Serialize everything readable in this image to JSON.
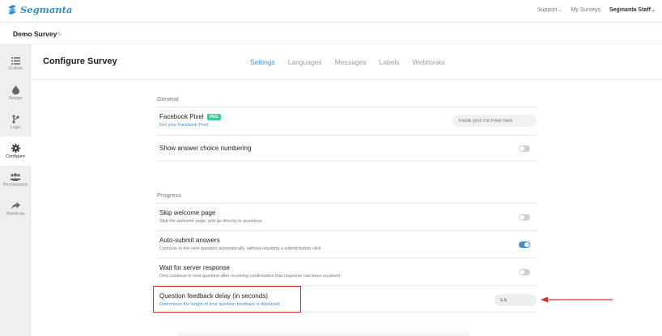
{
  "topbar": {
    "logo_text": "Segmanta",
    "support_label": "Support",
    "my_surveys_label": "My Surveys",
    "user_label": "Segmanta Staff"
  },
  "survey": {
    "title": "Demo Survey"
  },
  "sidebar": {
    "items": [
      {
        "label": "Outline",
        "icon": "list-icon"
      },
      {
        "label": "Design",
        "icon": "drop-icon"
      },
      {
        "label": "Logic",
        "icon": "branch-icon"
      },
      {
        "label": "Configure",
        "icon": "gear-icon"
      },
      {
        "label": "Permissions",
        "icon": "users-icon"
      },
      {
        "label": "Distribute",
        "icon": "share-icon"
      }
    ],
    "active": "Configure"
  },
  "page": {
    "title": "Configure Survey",
    "tabs": [
      {
        "label": "Settings",
        "active": true
      },
      {
        "label": "Languages",
        "active": false
      },
      {
        "label": "Messages",
        "active": false
      },
      {
        "label": "Labels",
        "active": false
      },
      {
        "label": "Webhooks",
        "active": false
      }
    ]
  },
  "general": {
    "heading": "General",
    "facebook_pixel": {
      "title": "Facebook Pixel",
      "badge": "PRO",
      "link": "Get your Facebook Pixel",
      "placeholder": "Paste your FB Pixel here"
    },
    "answer_numbering": {
      "title": "Show answer choice numbering",
      "enabled": false
    }
  },
  "progress": {
    "heading": "Progress",
    "skip_welcome": {
      "title": "Skip welcome page",
      "subtitle": "Skip the welcome page, and go directly to questions",
      "enabled": false
    },
    "auto_submit": {
      "title": "Auto-submit answers",
      "subtitle": "Continue to the next question automatically, without requiring a submit button click",
      "enabled": true
    },
    "wait_server": {
      "title": "Wait for server response",
      "subtitle": "Only continue to next question after receiving confirmation that response has been received",
      "enabled": false
    },
    "feedback_delay": {
      "title": "Question feedback delay (in seconds)",
      "subtitle": "Determines the length of time question feedback is displayed",
      "value": "1.5"
    }
  },
  "colors": {
    "accent": "#3b8ed8",
    "annotation": "#d32f2f",
    "pro_badge": "#3cc9a0"
  }
}
